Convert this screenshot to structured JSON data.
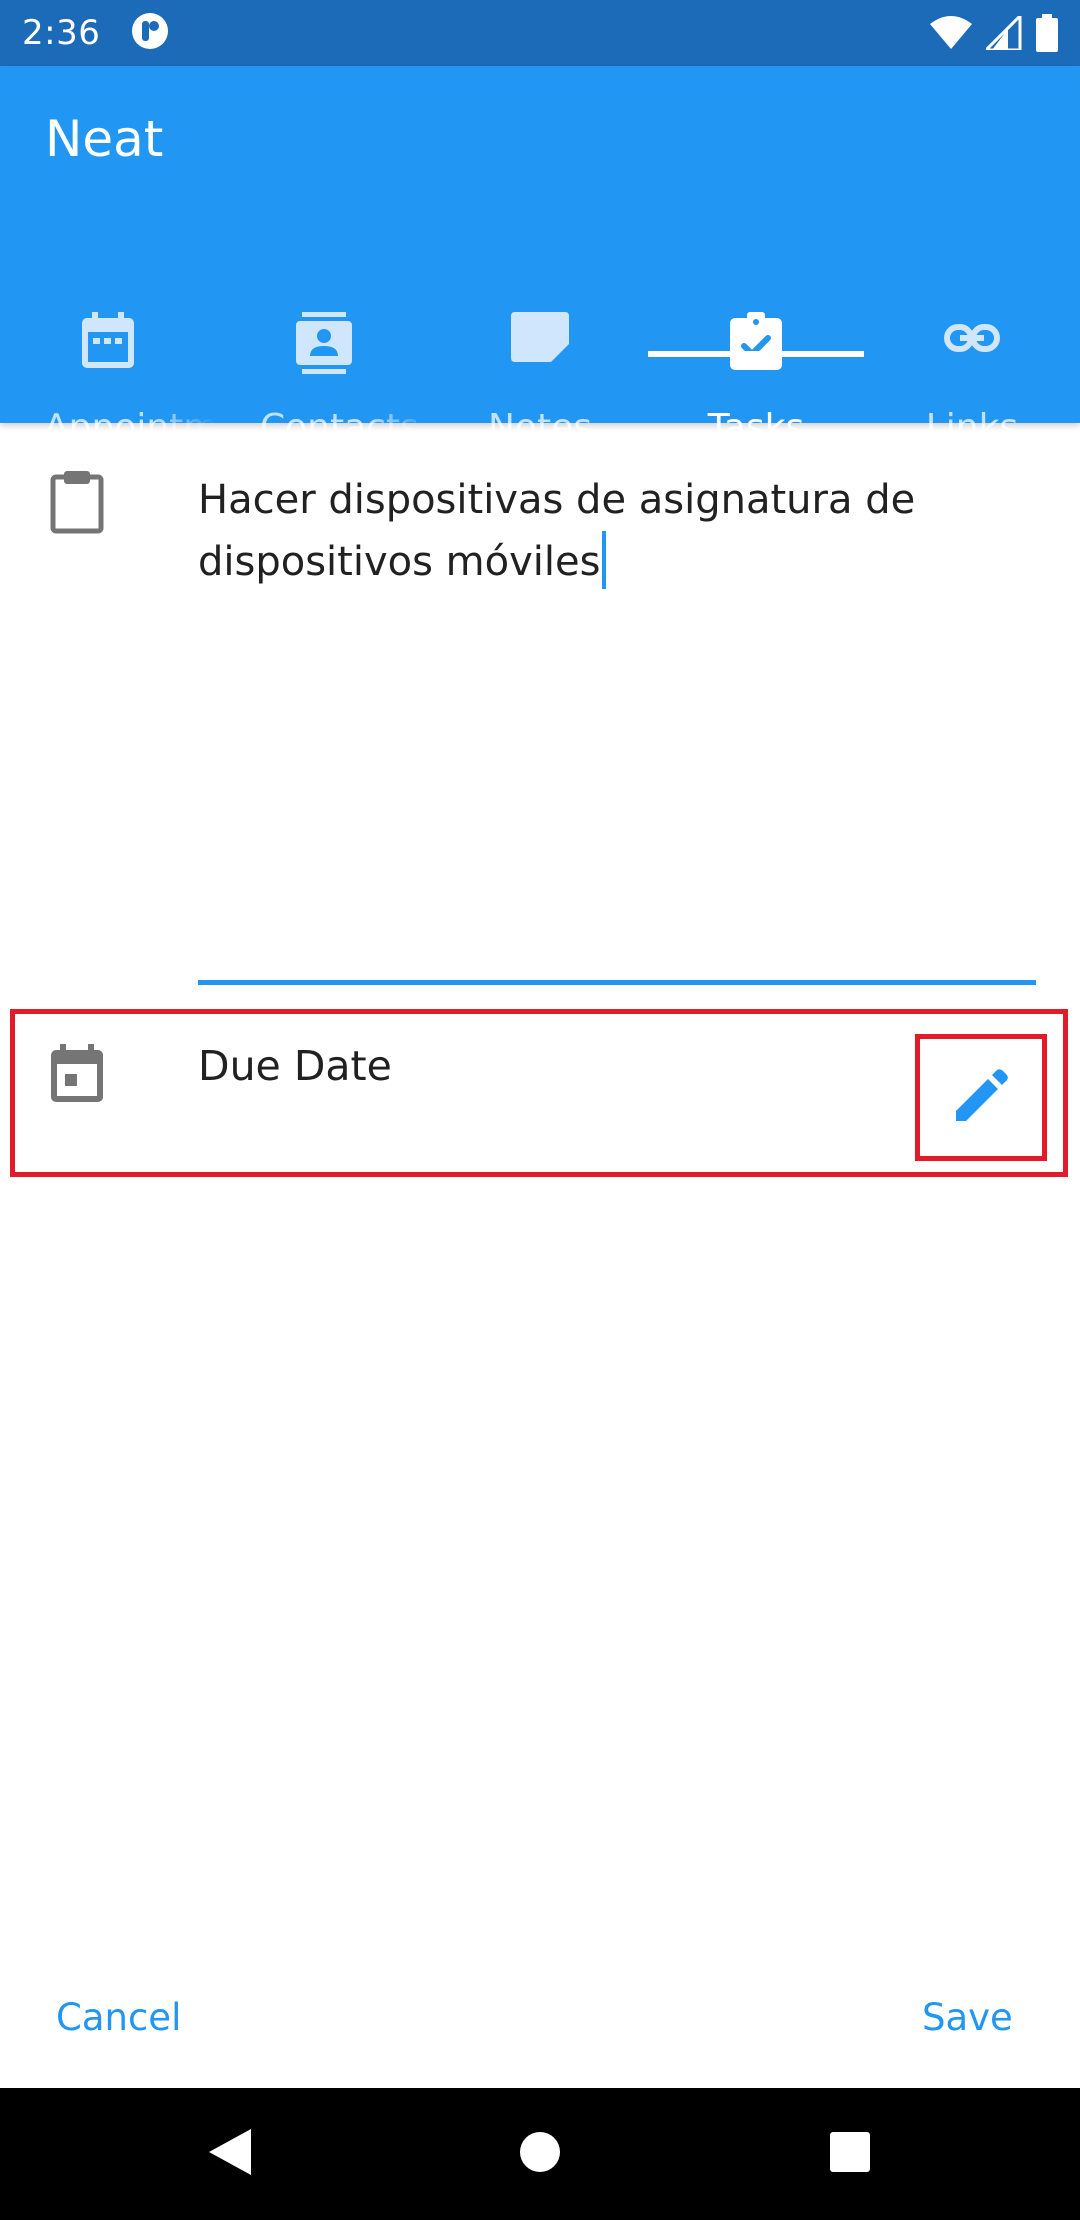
{
  "status_bar": {
    "time": "2:36",
    "icons": [
      "app-notification-icon",
      "wifi-icon",
      "signal-icon",
      "battery-icon"
    ]
  },
  "app_bar": {
    "title": "Neat",
    "tabs": [
      {
        "label": "Appointments",
        "icon": "calendar-icon",
        "active": false
      },
      {
        "label": "Contacts",
        "icon": "contact-icon",
        "active": false
      },
      {
        "label": "Notes",
        "icon": "note-icon",
        "active": false
      },
      {
        "label": "Tasks",
        "icon": "task-check-icon",
        "active": true
      },
      {
        "label": "Links",
        "icon": "link-icon",
        "active": false
      }
    ]
  },
  "task": {
    "description": "Hacer dispositivas de asignatura de dispositivos móviles",
    "icon": "clipboard-icon"
  },
  "due_date": {
    "label": "Due Date",
    "icon": "calendar-icon",
    "edit_icon": "pencil-icon"
  },
  "actions": {
    "cancel_label": "Cancel",
    "save_label": "Save"
  },
  "colors": {
    "primary": "#2196f3",
    "status_bar": "#1c6bb8",
    "highlight_border": "#e21b2a",
    "icon_gray": "#757575"
  },
  "nav_bar": {
    "buttons": [
      "back-icon",
      "home-icon",
      "recents-icon"
    ]
  }
}
